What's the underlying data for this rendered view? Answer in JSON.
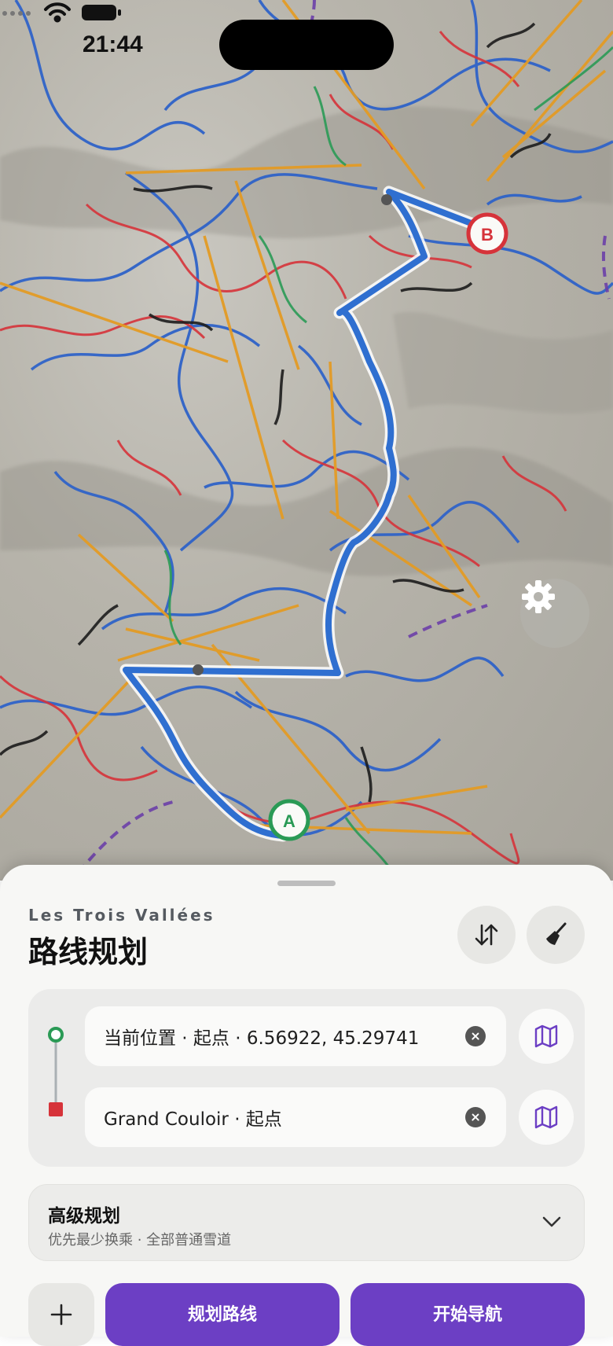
{
  "status": {
    "time": "21:44"
  },
  "map": {
    "resort_name": "Les Trois Vallées",
    "markers": {
      "start": "A",
      "end": "B"
    },
    "route_color": "#2f6fd0"
  },
  "sheet": {
    "subtitle": "Les Trois Vallées",
    "title": "路线规划",
    "origin": {
      "text": "当前位置 · 起点 · 6.56922, 45.29741"
    },
    "destination": {
      "text": "Grand Couloir · 起点"
    },
    "advanced": {
      "title": "高级规划",
      "summary": "优先最少换乘 · 全部普通雪道"
    },
    "buttons": {
      "plan": "规划路线",
      "navigate": "开始导航"
    },
    "accent_color": "#6c3fc4"
  }
}
